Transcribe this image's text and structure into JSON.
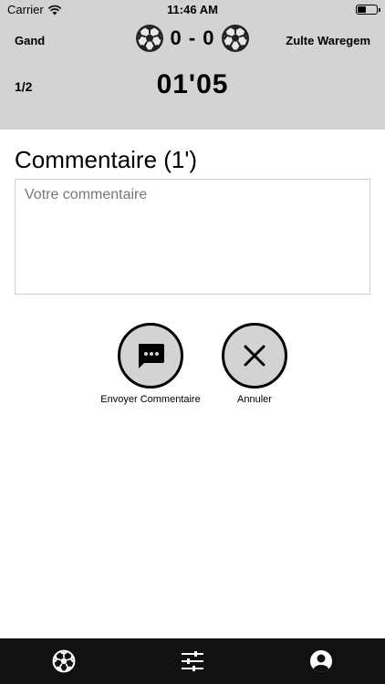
{
  "status_bar": {
    "carrier": "Carrier",
    "time": "11:46 AM",
    "battery_level": 0.45,
    "icons": [
      "wifi-icon",
      "battery-icon"
    ]
  },
  "header": {
    "home_team": "Gand",
    "away_team": "Zulte Waregem",
    "score": "0 - 0",
    "period": "1/2",
    "clock": "01'05",
    "icons": [
      "soccer-ball-icon"
    ]
  },
  "comment": {
    "title": "Commentaire (1')",
    "placeholder": "Votre commentaire",
    "value": ""
  },
  "actions": {
    "send_label": "Envoyer Commentaire",
    "cancel_label": "Annuler",
    "icons": [
      "chat-bubble-icon",
      "close-icon"
    ]
  },
  "tab_bar": {
    "tabs": [
      {
        "icon": "soccer-ball-icon"
      },
      {
        "icon": "sliders-icon"
      },
      {
        "icon": "user-icon"
      }
    ]
  },
  "colors": {
    "header_bg": "#d3d3d3",
    "tab_bar_bg": "#111111",
    "button_bg": "#d3d3d3",
    "text": "#000000"
  }
}
